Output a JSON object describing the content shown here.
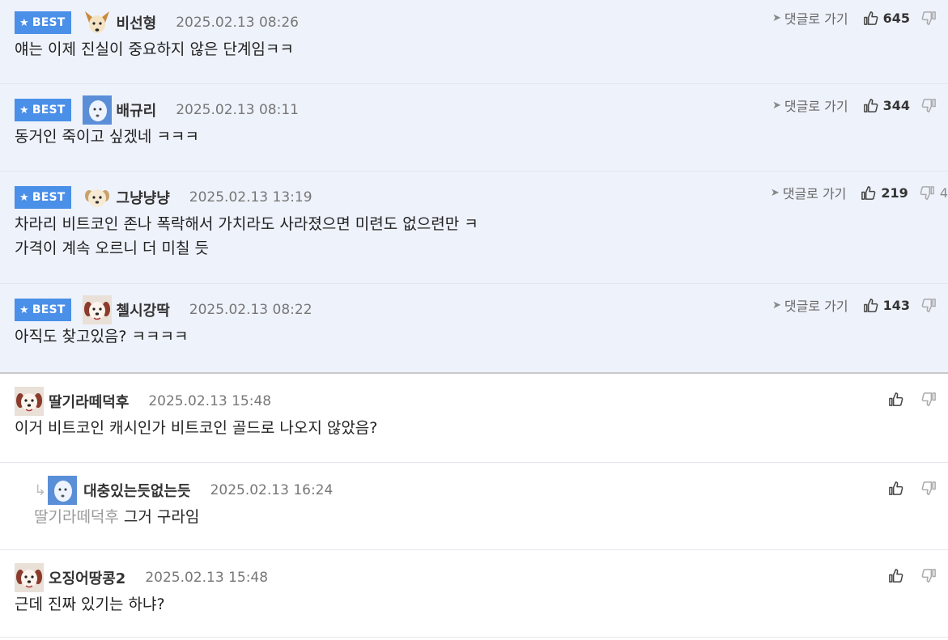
{
  "best_label": "BEST",
  "reply_link_label": "댓글로 가기",
  "best_comments": [
    {
      "nick": "비선형",
      "date": "2025.02.13 08:26",
      "text": [
        "얘는 이제 진실이 중요하지 않은 단계임ㅋㅋ"
      ],
      "likes": "645",
      "dislikes": "",
      "avatar": "dog-tan"
    },
    {
      "nick": "배규리",
      "date": "2025.02.13 08:11",
      "text": [
        "동거인 죽이고 싶겠네 ㅋㅋㅋ"
      ],
      "likes": "344",
      "dislikes": "",
      "avatar": "blue-face"
    },
    {
      "nick": "그냥냥냥",
      "date": "2025.02.13 13:19",
      "text": [
        "차라리 비트코인 존나 폭락해서 가치라도 사라졌으면 미련도 없으련만 ㅋ",
        "가격이 계속 오르니 더 미칠 듯"
      ],
      "likes": "219",
      "dislikes": "4",
      "avatar": "puppy"
    },
    {
      "nick": "첼시강딱",
      "date": "2025.02.13 08:22",
      "text": [
        "아직도 찾고있음? ㅋㅋㅋㅋ"
      ],
      "likes": "143",
      "dislikes": "",
      "avatar": "red-dog"
    }
  ],
  "comments": [
    {
      "nick": "딸기라떼덕후",
      "date": "2025.02.13 15:48",
      "text": "이거 비트코인 캐시인가 비트코인 골드로 나오지 않았음?",
      "avatar": "red-dog",
      "reply": false,
      "mention": ""
    },
    {
      "nick": "대충있는듯없는듯",
      "date": "2025.02.13 16:24",
      "text": "그거 구라임",
      "avatar": "blue-face",
      "reply": true,
      "mention": "딸기라떼덕후"
    },
    {
      "nick": "오징어땅콩2",
      "date": "2025.02.13 15:48",
      "text": "근데 진짜 있기는 하냐?",
      "avatar": "red-dog",
      "reply": false,
      "mention": ""
    }
  ]
}
